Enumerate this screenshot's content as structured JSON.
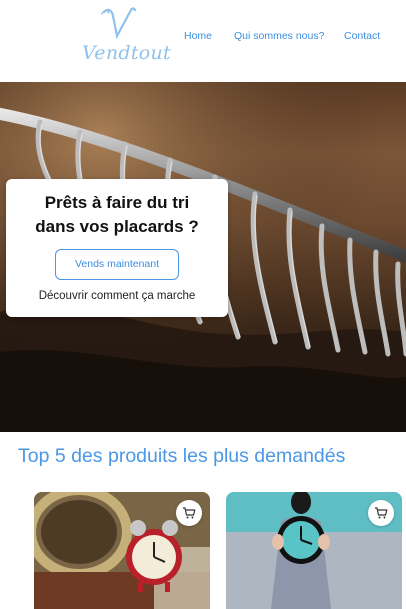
{
  "brand": {
    "name": "Vendtout",
    "monogram": "V"
  },
  "nav": {
    "items": [
      "Home",
      "Qui sommes nous?",
      "Contact"
    ]
  },
  "hero": {
    "title_line1": "Prêts à faire du tri",
    "title_line2": "dans vos placards ?",
    "button_label": "Vends maintenant",
    "link_label": "Découvrir comment ça marche"
  },
  "top_products": {
    "title": "Top 5 des produits les plus demandés"
  },
  "colors": {
    "accent": "#4a98e6",
    "logo": "#8fc2ec"
  }
}
